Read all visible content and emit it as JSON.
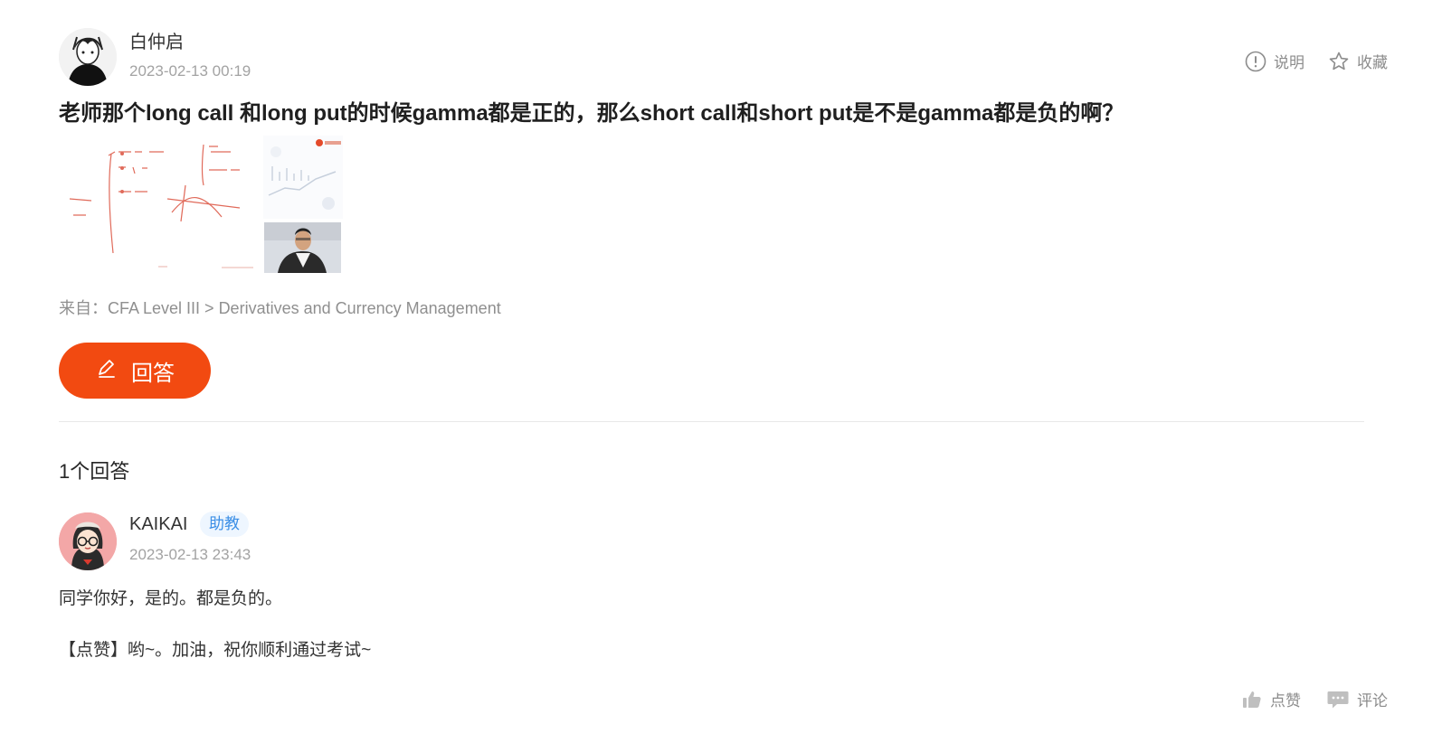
{
  "question": {
    "author": "白仲启",
    "time": "2023-02-13 00:19",
    "title": "老师那个long call 和long put的时候gamma都是正的，那么short call和short put是不是gamma都是负的啊？",
    "source": "来自：CFA Level III > Derivatives and Currency Management",
    "actions": {
      "explain_label": "说明",
      "favorite_label": "收藏"
    },
    "answer_button_label": "回答"
  },
  "answers_header": "1个回答",
  "answer": {
    "author": "KAIKAI",
    "badge": "助教",
    "time": "2023-02-13 23:43",
    "lines": [
      "同学你好，是的。都是负的。",
      "【点赞】哟~。加油，祝你顺利通过考试~"
    ],
    "actions": {
      "like_label": "点赞",
      "comment_label": "评论"
    }
  },
  "colors": {
    "accent": "#f24a11",
    "badge_text": "#3a8ee6",
    "badge_bg": "#eef6ff",
    "muted": "#a3a3a3"
  },
  "icons": {
    "explain": "info-circle-icon",
    "favorite": "star-outline-icon",
    "answer": "pencil-icon",
    "like": "thumbs-up-icon",
    "comment": "comment-bubble-icon"
  }
}
